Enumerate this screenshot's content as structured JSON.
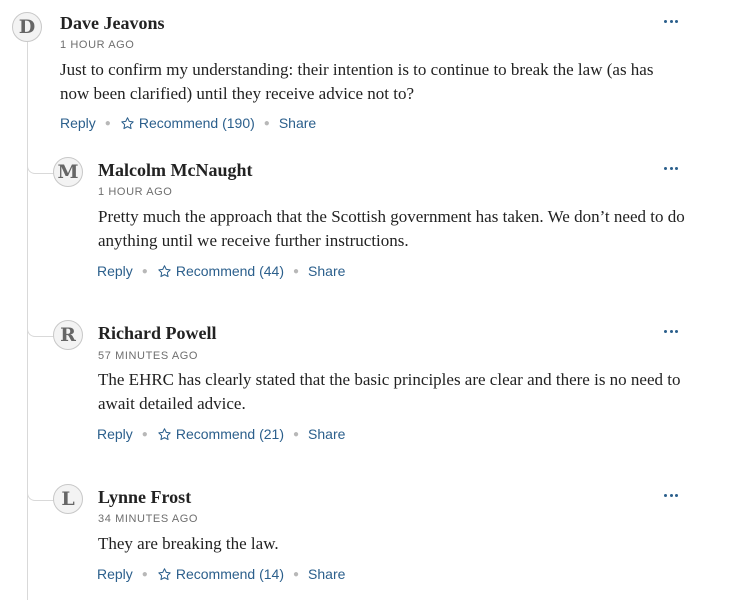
{
  "comments": [
    {
      "initial": "D",
      "author": "Dave Jeavons",
      "time": "1 HOUR AGO",
      "text": "Just to confirm my understanding: their intention is to continue to break the law (as has now been clarified) until they receive advice not to?",
      "reply": "Reply",
      "recommend": "Recommend (190)",
      "share": "Share"
    },
    {
      "initial": "M",
      "author": "Malcolm McNaught",
      "time": "1 HOUR AGO",
      "text": "Pretty much the approach that the Scottish government has taken. We don’t need to do anything until we receive further instructions.",
      "reply": "Reply",
      "recommend": "Recommend (44)",
      "share": "Share"
    },
    {
      "initial": "R",
      "author": "Richard Powell",
      "time": "57 MINUTES AGO",
      "text": "The EHRC has clearly stated that the basic principles are clear and there is no need to await detailed advice.",
      "reply": "Reply",
      "recommend": "Recommend (21)",
      "share": "Share"
    },
    {
      "initial": "L",
      "author": "Lynne Frost",
      "time": "34 MINUTES AGO",
      "text": "They are breaking the law.",
      "reply": "Reply",
      "recommend": "Recommend (14)",
      "share": "Share"
    }
  ],
  "icons": {
    "recommend": "star-outline-icon",
    "more": "more-options-icon"
  },
  "colors": {
    "link": "#2b5f8c",
    "text": "#222222",
    "meta": "#6e6e6e"
  }
}
